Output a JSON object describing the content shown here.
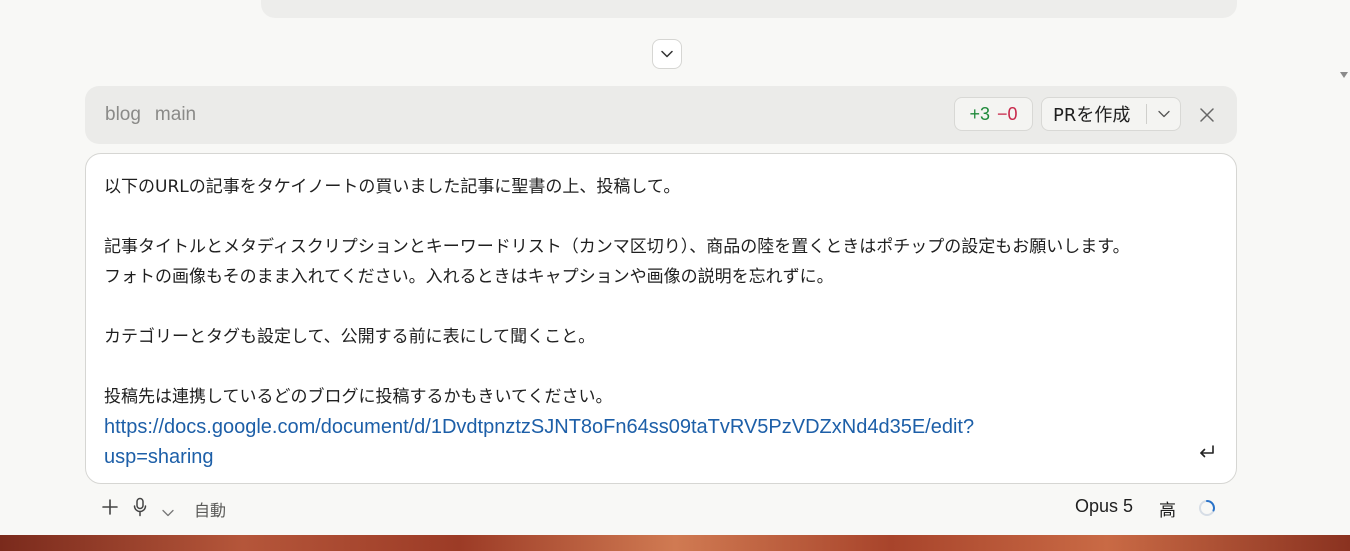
{
  "branch": {
    "repo": "blog",
    "name": "main",
    "additions": "+3",
    "deletions": "−0",
    "pr_button": "PRを作成"
  },
  "prompt": {
    "lines": [
      "以下のURLの記事をタケイノートの買いました記事に聖書の上、投稿して。",
      "",
      "記事タイトルとメタディスクリプションとキーワードリスト（カンマ区切り）、商品の陸を置くときはポチップの設定もお願いします。",
      "フォトの画像もそのまま入れてください。入れるときはキャプションや画像の説明を忘れずに。",
      "",
      "カテゴリーとタグも設定して、公開する前に表にして聞くこと。",
      "",
      "投稿先は連携しているどのブログに投稿するかもきいてください。"
    ],
    "link_line1": "https://docs.google.com/document/d/1DvdtpnztzSJNT8oFn64ss09taTvRV5PzVDZxNd4d35E/edit?",
    "link_line2": "usp=sharing"
  },
  "toolbar": {
    "mode": "自動",
    "model": "Opus 5",
    "effort": "高"
  },
  "colors": {
    "additions": "#1f8a3b",
    "deletions": "#c8284b",
    "link": "#1d5fa8"
  },
  "icons": [
    "chevron-down-icon",
    "close-icon",
    "enter-icon",
    "plus-icon",
    "microphone-icon",
    "spinner-icon"
  ]
}
